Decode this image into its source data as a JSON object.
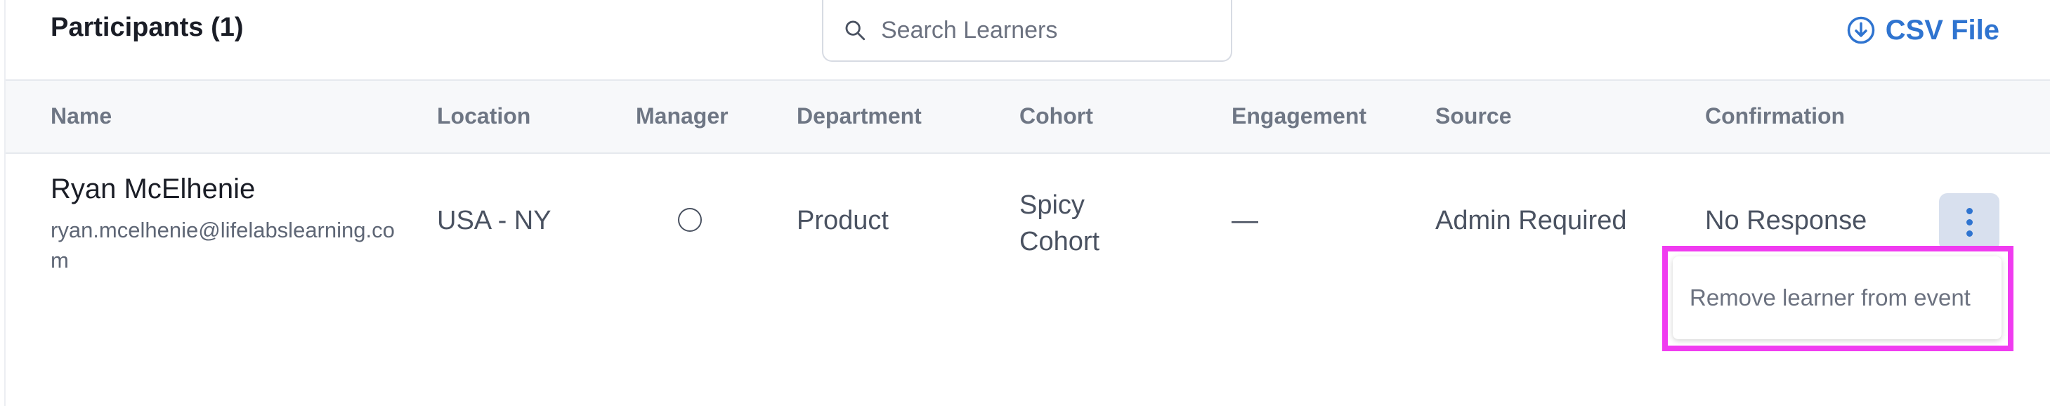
{
  "header": {
    "title": "Participants (1)",
    "search_placeholder": "Search Learners",
    "csv_label": "CSV File"
  },
  "table": {
    "columns": [
      "Name",
      "Location",
      "Manager",
      "Department",
      "Cohort",
      "Engagement",
      "Source",
      "Confirmation"
    ],
    "rows": [
      {
        "name": "Ryan McElhenie",
        "email": "ryan.mcelhenie@lifelabslearning.com",
        "location": "USA - NY",
        "manager_selected": false,
        "department": "Product",
        "cohort": "Spicy Cohort",
        "engagement": "—",
        "source": "Admin Required",
        "confirmation": "No Response"
      }
    ]
  },
  "row_menu": {
    "items": [
      "Remove learner from event"
    ]
  },
  "colors": {
    "accent": "#2f74d0",
    "highlight": "#f03bf0",
    "header_bg": "#f7f8fa",
    "kebab_bg": "#d8e0ee"
  },
  "icons": {
    "search": "search-icon",
    "csv": "download-circle-icon",
    "row_actions": "kebab-vertical-icon",
    "manager": "radio-icon"
  }
}
